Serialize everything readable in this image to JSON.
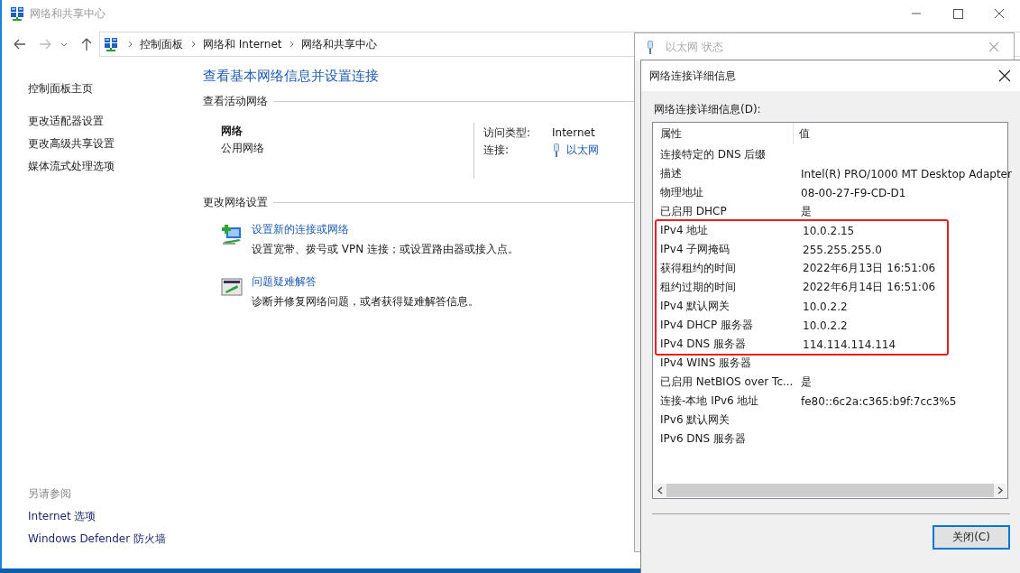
{
  "window": {
    "title": "网络和共享中心"
  },
  "breadcrumb": [
    "控制面板",
    "网络和 Internet",
    "网络和共享中心"
  ],
  "sidebar": {
    "items": [
      {
        "label": "控制面板主页"
      },
      {
        "label": "更改适配器设置"
      },
      {
        "label": "更改高级共享设置"
      },
      {
        "label": "媒体流式处理选项"
      }
    ],
    "see_also": {
      "heading": "另请参阅",
      "links": [
        "Internet 选项",
        "Windows Defender 防火墙"
      ]
    }
  },
  "main": {
    "heading": "查看基本网络信息并设置连接",
    "active_networks": {
      "heading": "查看活动网络",
      "network_name": "网络",
      "network_type": "公用网络",
      "access_type_label": "访问类型:",
      "access_type": "Internet",
      "connection_label": "连接:",
      "connection": "以太网"
    },
    "change_settings": {
      "heading": "更改网络设置",
      "tasks": [
        {
          "kind": "new-connection",
          "title": "设置新的连接或网络",
          "description": "设置宽带、拨号或 VPN 连接；或设置路由器或接入点。"
        },
        {
          "kind": "troubleshoot",
          "title": "问题疑难解答",
          "description": "诊断并修复网络问题，或者获得疑难解答信息。"
        }
      ]
    }
  },
  "status_dialog": {
    "title": "以太网 状态"
  },
  "details_dialog": {
    "title": "网络连接详细信息",
    "list_label": "网络连接详细信息(D):",
    "columns": [
      "属性",
      "值"
    ],
    "rows": [
      {
        "kind": "row",
        "property": "连接特定的 DNS 后缀"
      },
      {
        "kind": "row",
        "property": "描述",
        "value": "Intel(R) PRO/1000 MT Desktop Adapter"
      },
      {
        "kind": "row",
        "property": "物理地址",
        "value": "08-00-27-F9-CD-D1"
      },
      {
        "kind": "row",
        "property": "已启用 DHCP",
        "value": "是"
      },
      {
        "kind": "highlight-group",
        "rows": [
          {
            "property": "IPv4 地址",
            "value": "10.0.2.15"
          },
          {
            "property": "IPv4 子网掩码",
            "value": "255.255.255.0"
          },
          {
            "property": "获得租约的时间",
            "value": "2022年6月13日 16:51:06"
          },
          {
            "property": "租约过期的时间",
            "value": "2022年6月14日 16:51:06"
          },
          {
            "property": "IPv4 默认网关",
            "value": "10.0.2.2"
          },
          {
            "property": "IPv4 DHCP 服务器",
            "value": "10.0.2.2"
          },
          {
            "property": "IPv4 DNS 服务器",
            "value": "114.114.114.114"
          }
        ]
      },
      {
        "kind": "row",
        "property": "IPv4 WINS 服务器"
      },
      {
        "kind": "row",
        "property": "已启用 NetBIOS over Tc...",
        "value": "是"
      },
      {
        "kind": "row",
        "property": "连接-本地 IPv6 地址",
        "value": "fe80::6c2a:c365:b9f:7cc3%5"
      },
      {
        "kind": "row",
        "property": "IPv6 默认网关"
      },
      {
        "kind": "row",
        "property": "IPv6 DNS 服务器"
      }
    ],
    "close_button": "关闭(C)"
  }
}
